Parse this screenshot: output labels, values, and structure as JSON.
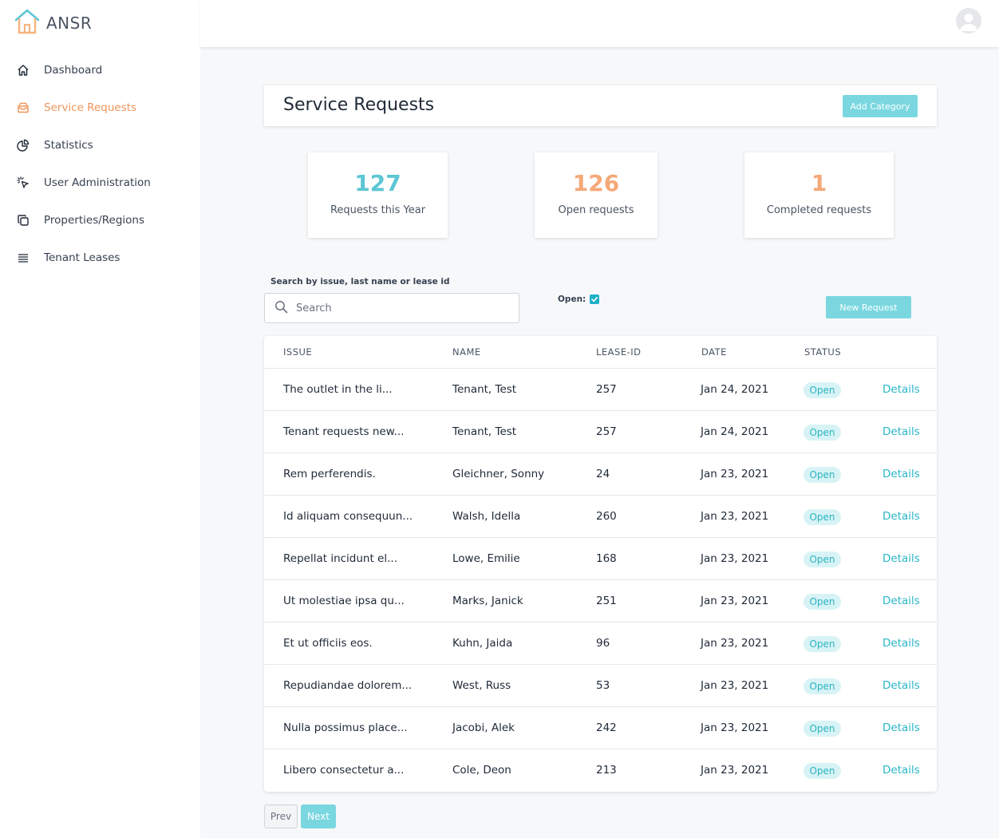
{
  "app": {
    "name": "ANSR",
    "logo_icon": "house-logo-icon",
    "avatar_icon": "user-avatar-icon"
  },
  "colors": {
    "accent_teal": "#7ad7e0",
    "active_orange": "#f0955a",
    "stat_teal": "#5cc6d4",
    "stat_orange": "#f5a878"
  },
  "sidebar": {
    "items": [
      {
        "label": "Dashboard",
        "icon": "home-icon",
        "active": false
      },
      {
        "label": "Service Requests",
        "icon": "tray-icon",
        "active": true
      },
      {
        "label": "Statistics",
        "icon": "pie-chart-icon",
        "active": false
      },
      {
        "label": "User Administration",
        "icon": "cursor-click-icon",
        "active": false
      },
      {
        "label": "Properties/Regions",
        "icon": "duplicate-icon",
        "active": false
      },
      {
        "label": "Tenant Leases",
        "icon": "menu-lines-icon",
        "active": false
      }
    ]
  },
  "header": {
    "title": "Service Requests",
    "add_category_label": "Add Category"
  },
  "stats": [
    {
      "value": "127",
      "label": "Requests this Year"
    },
    {
      "value": "126",
      "label": "Open requests"
    },
    {
      "value": "1",
      "label": "Completed requests"
    }
  ],
  "search": {
    "label": "Search by issue, last name or lease id",
    "placeholder": "Search",
    "value": ""
  },
  "filter": {
    "open_label": "Open:",
    "open_checked": true
  },
  "new_request_label": "New Request",
  "table": {
    "columns": [
      "ISSUE",
      "NAME",
      "LEASE-ID",
      "DATE",
      "STATUS"
    ],
    "rows": [
      {
        "issue": "The outlet in the li...",
        "name": "Tenant, Test",
        "lease_id": "257",
        "date": "Jan 24, 2021",
        "status": "Open",
        "action": "Details"
      },
      {
        "issue": "Tenant requests new...",
        "name": "Tenant, Test",
        "lease_id": "257",
        "date": "Jan 24, 2021",
        "status": "Open",
        "action": "Details"
      },
      {
        "issue": "Rem perferendis.",
        "name": "Gleichner, Sonny",
        "lease_id": "24",
        "date": "Jan 23, 2021",
        "status": "Open",
        "action": "Details"
      },
      {
        "issue": "Id aliquam consequun...",
        "name": "Walsh, Idella",
        "lease_id": "260",
        "date": "Jan 23, 2021",
        "status": "Open",
        "action": "Details"
      },
      {
        "issue": "Repellat incidunt el...",
        "name": "Lowe, Emilie",
        "lease_id": "168",
        "date": "Jan 23, 2021",
        "status": "Open",
        "action": "Details"
      },
      {
        "issue": "Ut molestiae ipsa qu...",
        "name": "Marks, Janick",
        "lease_id": "251",
        "date": "Jan 23, 2021",
        "status": "Open",
        "action": "Details"
      },
      {
        "issue": "Et ut officiis eos.",
        "name": "Kuhn, Jaida",
        "lease_id": "96",
        "date": "Jan 23, 2021",
        "status": "Open",
        "action": "Details"
      },
      {
        "issue": "Repudiandae dolorem...",
        "name": "West, Russ",
        "lease_id": "53",
        "date": "Jan 23, 2021",
        "status": "Open",
        "action": "Details"
      },
      {
        "issue": "Nulla possimus place...",
        "name": "Jacobi, Alek",
        "lease_id": "242",
        "date": "Jan 23, 2021",
        "status": "Open",
        "action": "Details"
      },
      {
        "issue": "Libero consectetur a...",
        "name": "Cole, Deon",
        "lease_id": "213",
        "date": "Jan 23, 2021",
        "status": "Open",
        "action": "Details"
      }
    ]
  },
  "pagination": {
    "prev_label": "Prev",
    "next_label": "Next"
  }
}
